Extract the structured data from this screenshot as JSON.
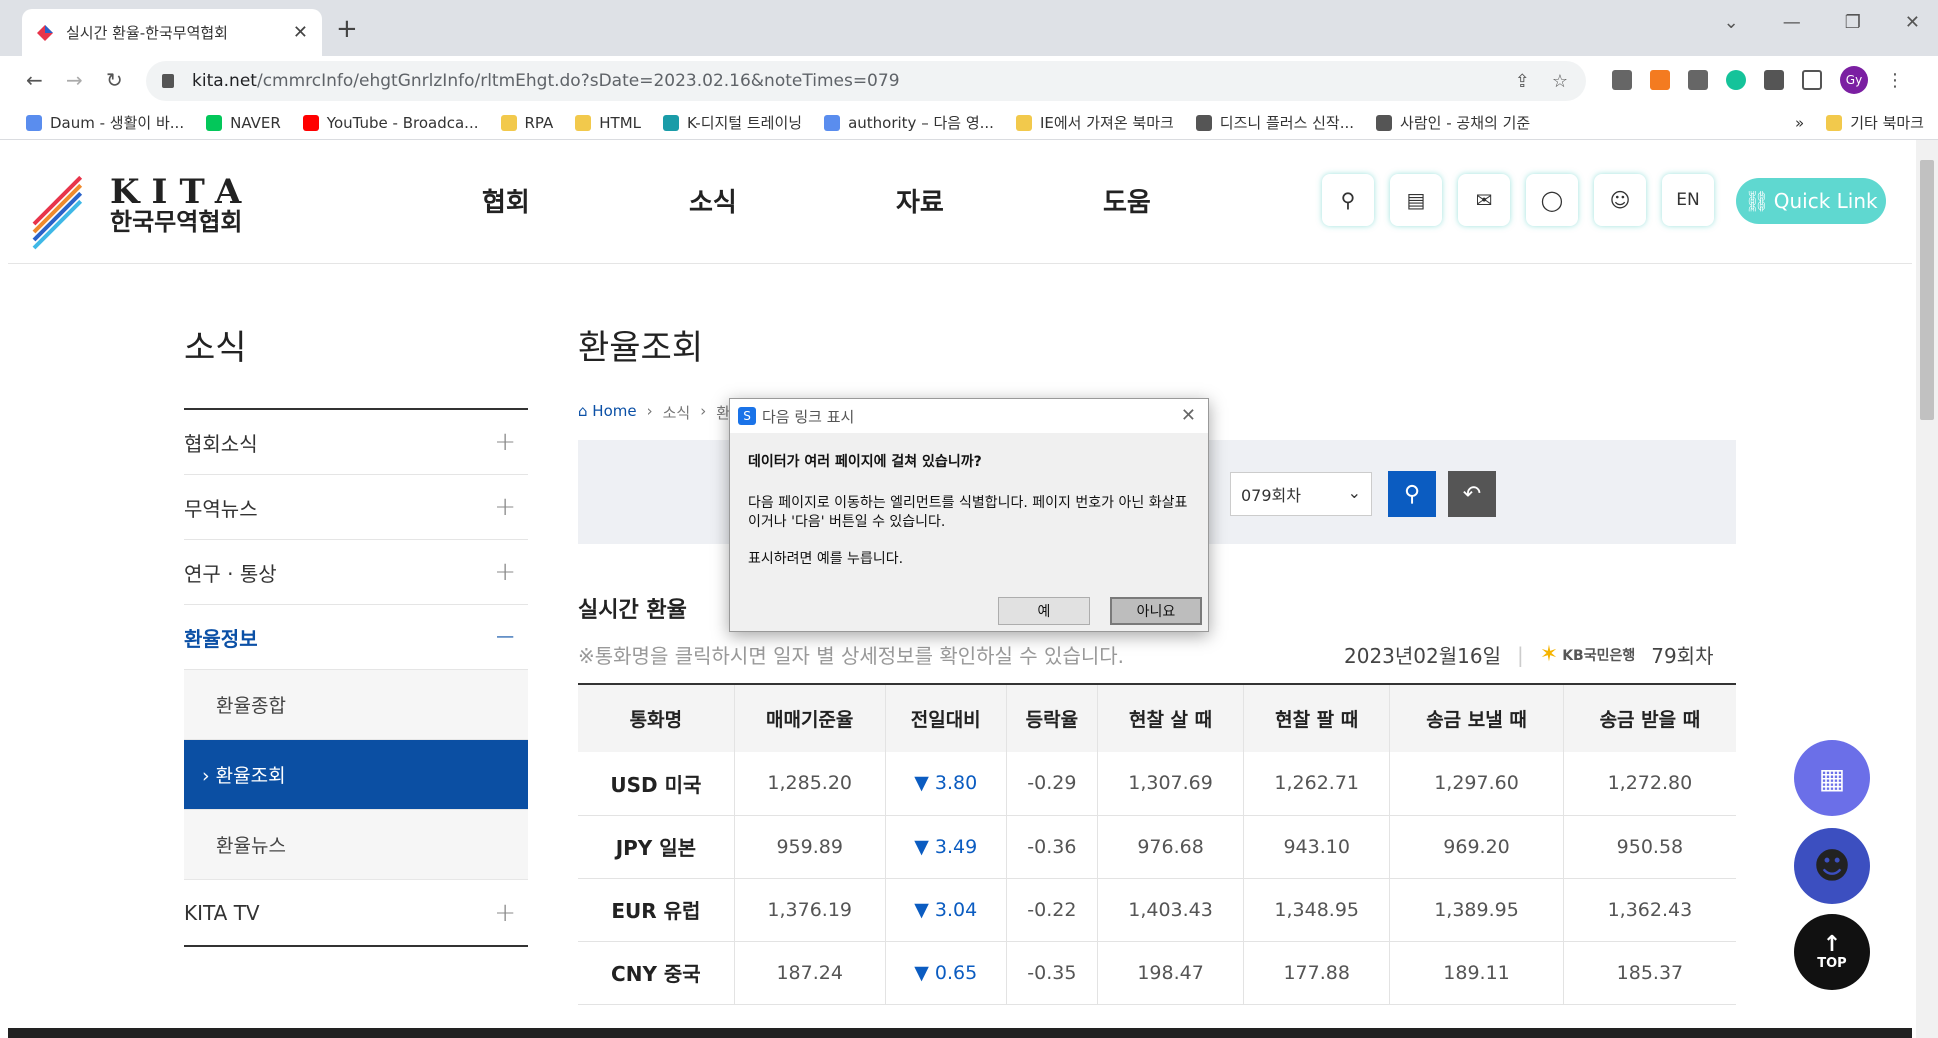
{
  "browser": {
    "tab_title": "실시간 환율-한국무역협회",
    "url_host": "kita.net",
    "url_path": "/cmmrcInfo/ehgtGnrlzInfo/rltmEhgt.do?sDate=2023.02.16&noteTimes=079",
    "profile_initials": "Gy"
  },
  "bookmarks": [
    {
      "label": "Daum - 생활이 바...",
      "color": "#5a8dee"
    },
    {
      "label": "NAVER",
      "color": "#03c75a"
    },
    {
      "label": "YouTube - Broadca...",
      "color": "#ff0000"
    },
    {
      "label": "RPA",
      "color": "#f2c94c"
    },
    {
      "label": "HTML",
      "color": "#f2c94c"
    },
    {
      "label": "K-디지털 트레이닝",
      "color": "#1a9ca8"
    },
    {
      "label": "authority – 다음 영...",
      "color": "#5a8dee"
    },
    {
      "label": "IE에서 가져온 북마크",
      "color": "#f2c94c"
    },
    {
      "label": "디즈니 플러스 신작...",
      "color": "#555555"
    },
    {
      "label": "사람인 - 공채의 기준",
      "color": "#555555"
    }
  ],
  "bookmarks_more": "»",
  "bookmarks_other": "기타 북마크",
  "site": {
    "logo_en": "KITA",
    "logo_kr": "한국무역협회",
    "gnb": [
      "협회",
      "소식",
      "자료",
      "도움"
    ],
    "lang": "EN",
    "quick_link": "Quick Link"
  },
  "lnb": {
    "title": "소식",
    "items": [
      {
        "label": "협회소식",
        "sign": "+"
      },
      {
        "label": "무역뉴스",
        "sign": "+"
      },
      {
        "label": "연구 · 통상",
        "sign": "+"
      },
      {
        "label": "환율정보",
        "sign": "−"
      }
    ],
    "sub": [
      "환율종합",
      "› 환율조회",
      "환율뉴스"
    ],
    "last": {
      "label": "KITA TV",
      "sign": "+"
    }
  },
  "content": {
    "title": "환율조회",
    "breadcrumb": [
      "Home",
      "소식",
      "환"
    ],
    "round_select": "079회차",
    "section_title": "실시간 환율",
    "note": "※통화명을 클릭하시면 일자 별 상세정보를 확인하실 수 있습니다.",
    "date": "2023년02월16일",
    "bank": "KB국민은행",
    "round": "79회차",
    "table": {
      "headers": [
        "통화명",
        "매매기준율",
        "전일대비",
        "등락율",
        "현찰 살 때",
        "현찰 팔 때",
        "송금 보낼 때",
        "송금 받을 때"
      ],
      "rows": [
        [
          "USD 미국",
          "1,285.20",
          "▼ 3.80",
          "-0.29",
          "1,307.69",
          "1,262.71",
          "1,297.60",
          "1,272.80"
        ],
        [
          "JPY 일본",
          "959.89",
          "▼ 3.49",
          "-0.36",
          "976.68",
          "943.10",
          "969.20",
          "950.58"
        ],
        [
          "EUR 유럽",
          "1,376.19",
          "▼ 3.04",
          "-0.22",
          "1,403.43",
          "1,348.95",
          "1,389.95",
          "1,362.43"
        ],
        [
          "CNY 중국",
          "187.24",
          "▼ 0.65",
          "-0.35",
          "198.47",
          "177.88",
          "189.11",
          "185.37"
        ]
      ]
    }
  },
  "floating": {
    "top": "TOP"
  },
  "dialog": {
    "title": "다음 링크 표시",
    "question": "데이터가 여러 페이지에 걸쳐 있습니까?",
    "description": "다음 페이지로 이동하는 엘리먼트를 식별합니다. 페이지 번호가 아닌 화살표이거나 '다음' 버튼일 수 있습니다.",
    "instruction": "표시하려면 예를 누릅니다.",
    "yes": "예",
    "no": "아니요"
  }
}
